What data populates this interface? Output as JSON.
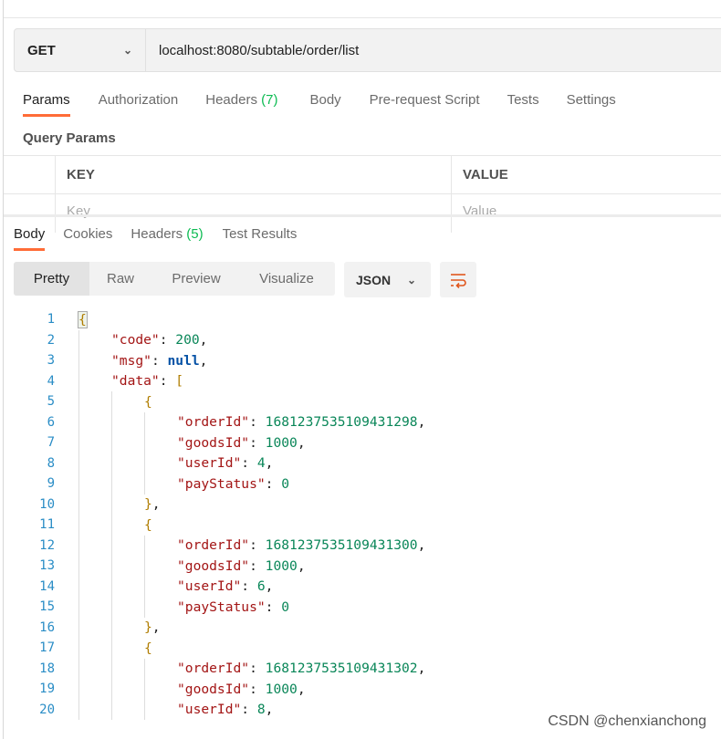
{
  "request": {
    "method": "GET",
    "url": "localhost:8080/subtable/order/list"
  },
  "request_tabs": [
    {
      "label": "Params"
    },
    {
      "label": "Authorization"
    },
    {
      "label": "Headers",
      "count": "(7)"
    },
    {
      "label": "Body"
    },
    {
      "label": "Pre-request Script"
    },
    {
      "label": "Tests"
    },
    {
      "label": "Settings"
    }
  ],
  "query_params": {
    "title": "Query Params",
    "key_header": "KEY",
    "value_header": "VALUE",
    "key_placeholder": "Key",
    "value_placeholder": "Value"
  },
  "response_tabs": [
    {
      "label": "Body"
    },
    {
      "label": "Cookies"
    },
    {
      "label": "Headers",
      "count": "(5)"
    },
    {
      "label": "Test Results"
    }
  ],
  "view_modes": [
    "Pretty",
    "Raw",
    "Preview",
    "Visualize"
  ],
  "format": "JSON",
  "colors": {
    "accent": "#ff6c37",
    "count": "#0cbb52"
  },
  "code_lines": [
    "{",
    "    \"code\": 200,",
    "    \"msg\": null,",
    "    \"data\": [",
    "        {",
    "            \"orderId\": 1681237535109431298,",
    "            \"goodsId\": 1000,",
    "            \"userId\": 4,",
    "            \"payStatus\": 0",
    "        },",
    "        {",
    "            \"orderId\": 1681237535109431300,",
    "            \"goodsId\": 1000,",
    "            \"userId\": 6,",
    "            \"payStatus\": 0",
    "        },",
    "        {",
    "            \"orderId\": 1681237535109431302,",
    "            \"goodsId\": 1000,",
    "            \"userId\": 8,"
  ],
  "footer": "CSDN @chenxianchong"
}
